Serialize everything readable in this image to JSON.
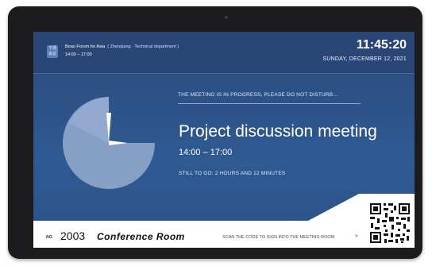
{
  "header": {
    "tag_text": "下场会议",
    "org_name": "Boao Forum for Asia",
    "department": "( Zhenqiang · Technical department )",
    "next_time": "14:00 – 17:00",
    "clock": "11:45:20",
    "date": "SUNDAY, DECEMBER 12, 2021"
  },
  "meeting": {
    "status": "THE MEETING IS IN PROGRESS, PLEASE DO NOT DISTURB...",
    "title": "Project discussion meeting",
    "time_range": "14:00 – 17:00",
    "remaining": "STILL TO GO: 2 HOURS AND 12 MINUTES"
  },
  "footer": {
    "no_label": "NO.",
    "room_number": "2003",
    "room_name": "Conference Room",
    "scan_text": "SCAN THE CODE TO SIGN INTO THE MEETING ROOM",
    "chevron": "»"
  },
  "colors": {
    "screen_top": "#2a4676",
    "screen_body": "#2f5a92",
    "clock_face": "#8aa3c8",
    "hand": "#ffffff"
  },
  "icons": [
    "clock-pie-icon",
    "qr-code-icon",
    "chevron-right-icon"
  ]
}
